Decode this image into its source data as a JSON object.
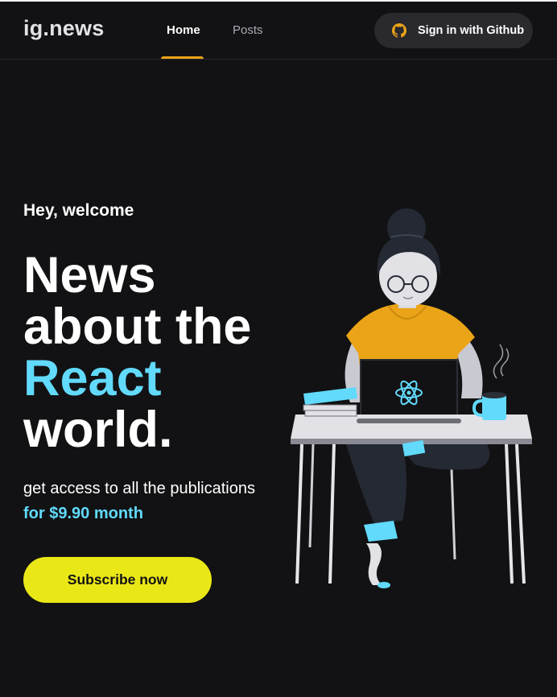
{
  "header": {
    "logo": "ig.news",
    "nav": [
      {
        "label": "Home",
        "active": true
      },
      {
        "label": "Posts",
        "active": false
      }
    ],
    "signin_label": "Sign in with Github",
    "signin_icon": "github-icon"
  },
  "hero": {
    "greeting": "Hey, welcome",
    "headline": [
      "News",
      "about the",
      "React",
      "world."
    ],
    "description": "get access to all the publications",
    "price": "for $9.90 month",
    "subscribe_label": "Subscribe now",
    "illustration": "woman-at-laptop-illustration"
  },
  "colors": {
    "background": "#121214",
    "accent_yellow": "#eba417",
    "react_cyan": "#61dafb",
    "button_yellow": "#eae717"
  }
}
